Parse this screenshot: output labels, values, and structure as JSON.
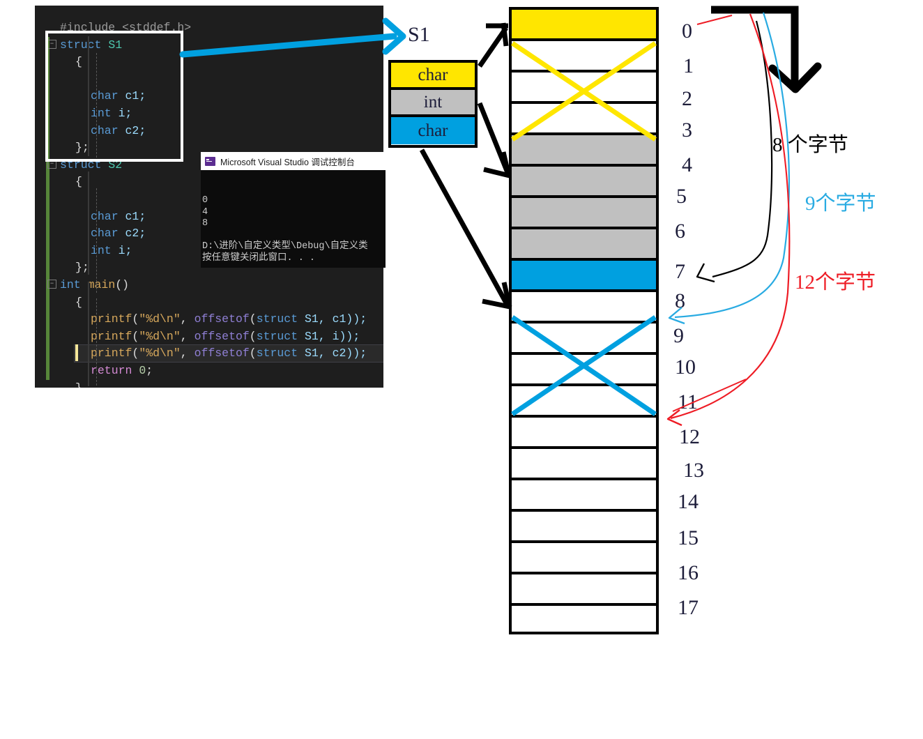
{
  "editor": {
    "lines": [
      {
        "indent": 0,
        "fold": false,
        "tokens": [
          {
            "t": "#include <stddef.h>",
            "c": "c-pre"
          }
        ]
      },
      {
        "indent": 0,
        "fold": true,
        "tokens": [
          {
            "t": "struct ",
            "c": "c-kw"
          },
          {
            "t": "S1",
            "c": "c-type"
          }
        ]
      },
      {
        "indent": 1,
        "fold": false,
        "tokens": [
          {
            "t": "{",
            "c": "c-punc"
          }
        ]
      },
      {
        "indent": 1,
        "fold": false,
        "tokens": [
          {
            "t": "",
            "c": "c-plain"
          }
        ]
      },
      {
        "indent": 2,
        "fold": false,
        "tokens": [
          {
            "t": "char",
            "c": "c-kw"
          },
          {
            "t": " c1;",
            "c": "c-var"
          }
        ]
      },
      {
        "indent": 2,
        "fold": false,
        "tokens": [
          {
            "t": "int",
            "c": "c-kw"
          },
          {
            "t": " i;",
            "c": "c-var"
          }
        ]
      },
      {
        "indent": 2,
        "fold": false,
        "tokens": [
          {
            "t": "char",
            "c": "c-kw"
          },
          {
            "t": " c2;",
            "c": "c-var"
          }
        ]
      },
      {
        "indent": 1,
        "fold": false,
        "tokens": [
          {
            "t": "};",
            "c": "c-punc"
          }
        ]
      },
      {
        "indent": 0,
        "fold": true,
        "tokens": [
          {
            "t": "struct ",
            "c": "c-kw"
          },
          {
            "t": "S2",
            "c": "c-type"
          }
        ]
      },
      {
        "indent": 1,
        "fold": false,
        "tokens": [
          {
            "t": "{",
            "c": "c-punc"
          }
        ]
      },
      {
        "indent": 1,
        "fold": false,
        "tokens": [
          {
            "t": "",
            "c": "c-plain"
          }
        ]
      },
      {
        "indent": 2,
        "fold": false,
        "tokens": [
          {
            "t": "char",
            "c": "c-kw"
          },
          {
            "t": " c1;",
            "c": "c-var"
          }
        ]
      },
      {
        "indent": 2,
        "fold": false,
        "tokens": [
          {
            "t": "char",
            "c": "c-kw"
          },
          {
            "t": " c2;",
            "c": "c-var"
          }
        ]
      },
      {
        "indent": 2,
        "fold": false,
        "tokens": [
          {
            "t": "int",
            "c": "c-kw"
          },
          {
            "t": " i;",
            "c": "c-var"
          }
        ]
      },
      {
        "indent": 1,
        "fold": false,
        "tokens": [
          {
            "t": "};",
            "c": "c-punc"
          }
        ]
      },
      {
        "indent": 0,
        "fold": true,
        "tokens": [
          {
            "t": "int",
            "c": "c-kw"
          },
          {
            "t": " ",
            "c": "c-plain"
          },
          {
            "t": "main",
            "c": "c-str"
          },
          {
            "t": "()",
            "c": "c-punc"
          }
        ]
      },
      {
        "indent": 1,
        "fold": false,
        "tokens": [
          {
            "t": "{",
            "c": "c-punc"
          }
        ]
      },
      {
        "indent": 2,
        "fold": false,
        "tokens": [
          {
            "t": "printf",
            "c": "c-str"
          },
          {
            "t": "(",
            "c": "c-punc"
          },
          {
            "t": "\"%d\\n\"",
            "c": "c-str"
          },
          {
            "t": ", ",
            "c": "c-punc"
          },
          {
            "t": "offsetof",
            "c": "c-fn"
          },
          {
            "t": "(",
            "c": "c-punc"
          },
          {
            "t": "struct",
            "c": "c-kw"
          },
          {
            "t": " S1, c1));",
            "c": "c-var"
          }
        ]
      },
      {
        "indent": 2,
        "fold": false,
        "tokens": [
          {
            "t": "printf",
            "c": "c-str"
          },
          {
            "t": "(",
            "c": "c-punc"
          },
          {
            "t": "\"%d\\n\"",
            "c": "c-str"
          },
          {
            "t": ", ",
            "c": "c-punc"
          },
          {
            "t": "offsetof",
            "c": "c-fn"
          },
          {
            "t": "(",
            "c": "c-punc"
          },
          {
            "t": "struct",
            "c": "c-kw"
          },
          {
            "t": " S1, i));",
            "c": "c-var"
          }
        ]
      },
      {
        "indent": 2,
        "fold": false,
        "highlight": true,
        "tokens": [
          {
            "t": "printf",
            "c": "c-str"
          },
          {
            "t": "(",
            "c": "c-punc"
          },
          {
            "t": "\"%d\\n\"",
            "c": "c-str"
          },
          {
            "t": ", ",
            "c": "c-punc"
          },
          {
            "t": "offsetof",
            "c": "c-fn"
          },
          {
            "t": "(",
            "c": "c-punc"
          },
          {
            "t": "struct",
            "c": "c-kw"
          },
          {
            "t": " S1, c2));",
            "c": "c-var"
          }
        ]
      },
      {
        "indent": 2,
        "fold": false,
        "tokens": [
          {
            "t": "return",
            "c": "c-ret"
          },
          {
            "t": " ",
            "c": "c-plain"
          },
          {
            "t": "0",
            "c": "c-num"
          },
          {
            "t": ";",
            "c": "c-punc"
          }
        ]
      },
      {
        "indent": 1,
        "fold": false,
        "tokens": [
          {
            "t": "}",
            "c": "c-punc"
          }
        ]
      }
    ]
  },
  "console": {
    "title": "Microsoft Visual Studio 调试控制台",
    "icon": "cmd-icon",
    "output_lines": [
      "0",
      "4",
      "8",
      "",
      "D:\\进阶\\自定义类型\\Debug\\自定义类",
      "按任意键关闭此窗口. . ."
    ]
  },
  "legend": {
    "title": "S1",
    "rows": [
      {
        "label": "char",
        "color": "#ffe600"
      },
      {
        "label": "int",
        "color": "#c0c0c0"
      },
      {
        "label": "char",
        "color": "#00a0e0"
      }
    ]
  },
  "memory": {
    "indices": [
      "0",
      "1",
      "2",
      "3",
      "4",
      "5",
      "6",
      "7",
      "8",
      "9",
      "10",
      "11",
      "12",
      "13",
      "14",
      "15",
      "16",
      "17"
    ],
    "cells": [
      {
        "index": "0",
        "fill": "#ffe600",
        "kind": "char-c1"
      },
      {
        "index": "1",
        "fill": "#ffffff",
        "kind": "padding"
      },
      {
        "index": "2",
        "fill": "#ffffff",
        "kind": "padding"
      },
      {
        "index": "3",
        "fill": "#ffffff",
        "kind": "padding"
      },
      {
        "index": "4",
        "fill": "#c0c0c0",
        "kind": "int-i"
      },
      {
        "index": "5",
        "fill": "#c0c0c0",
        "kind": "int-i"
      },
      {
        "index": "6",
        "fill": "#c0c0c0",
        "kind": "int-i"
      },
      {
        "index": "7",
        "fill": "#c0c0c0",
        "kind": "int-i"
      },
      {
        "index": "8",
        "fill": "#00a0e0",
        "kind": "char-c2"
      },
      {
        "index": "9",
        "fill": "#ffffff",
        "kind": "padding"
      },
      {
        "index": "10",
        "fill": "#ffffff",
        "kind": "padding"
      },
      {
        "index": "11",
        "fill": "#ffffff",
        "kind": "padding"
      },
      {
        "index": "12",
        "fill": "#ffffff",
        "kind": "empty"
      },
      {
        "index": "13",
        "fill": "#ffffff",
        "kind": "empty"
      },
      {
        "index": "14",
        "fill": "#ffffff",
        "kind": "empty"
      },
      {
        "index": "15",
        "fill": "#ffffff",
        "kind": "empty"
      },
      {
        "index": "16",
        "fill": "#ffffff",
        "kind": "empty"
      },
      {
        "index": "17",
        "fill": "#ffffff",
        "kind": "empty"
      },
      {
        "index": "",
        "fill": "#ffffff",
        "kind": "empty"
      },
      {
        "index": "",
        "fill": "#ffffff",
        "kind": "empty"
      }
    ]
  },
  "annotations": [
    {
      "id": "bytes-8",
      "text": "8 个字节",
      "color": "#000000"
    },
    {
      "id": "bytes-9",
      "text": "9个字节",
      "color": "#29abe2"
    },
    {
      "id": "bytes-12",
      "text": "12个字节",
      "color": "#ee1c25"
    }
  ],
  "colors": {
    "yellow": "#ffe600",
    "gray": "#c0c0c0",
    "blue": "#00a0e0",
    "red": "#ee1c25",
    "black": "#000000",
    "sky": "#29abe2"
  }
}
